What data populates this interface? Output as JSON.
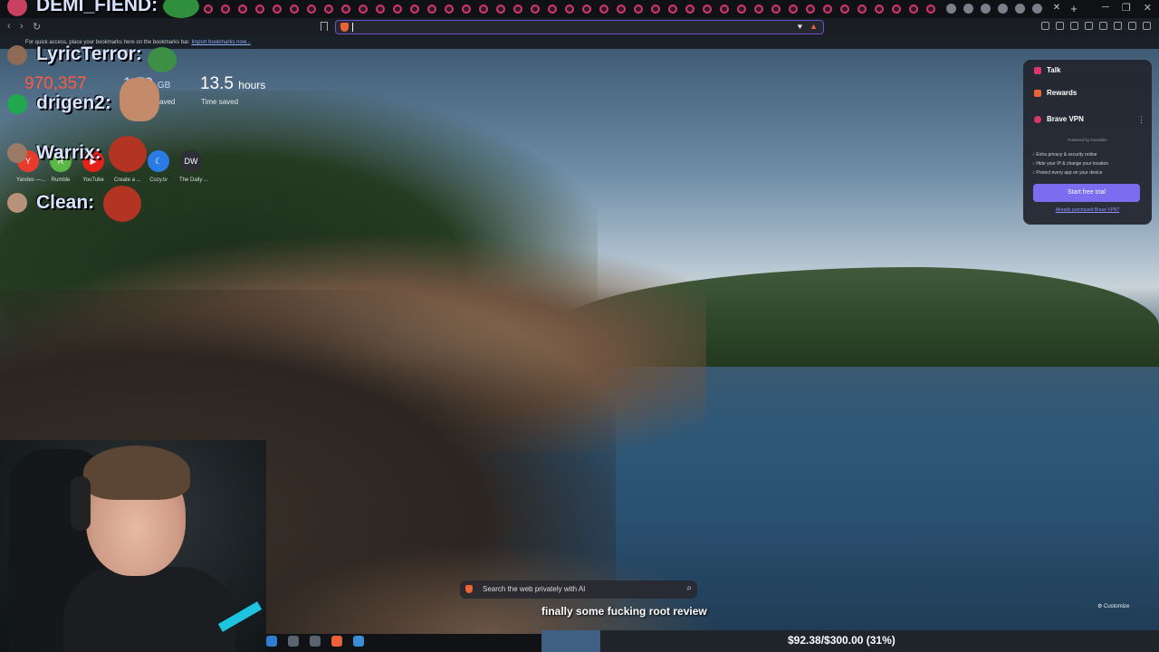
{
  "browser": {
    "url_value": "",
    "bookmarks_hint": "For quick access, place your bookmarks here on the bookmarks bar.",
    "import_link": "Import bookmarks now..."
  },
  "stats": {
    "trackers_value": "970,357",
    "bandwidth_value": "1.79",
    "bandwidth_unit": "GB",
    "bandwidth_caption": "saved",
    "time_value": "13.5",
    "time_unit": "hours",
    "time_caption": "Time saved"
  },
  "top_sites": [
    {
      "label": "Yandex —...",
      "icon": "Y",
      "color": "#e83b2e"
    },
    {
      "label": "Rumble",
      "icon": "R",
      "color": "#5ab945"
    },
    {
      "label": "YouTube",
      "icon": "▶",
      "color": "#e62117"
    },
    {
      "label": "Create a ...",
      "icon": "✎",
      "color": "#3a3c44"
    },
    {
      "label": "Cozy.tv",
      "icon": "☾",
      "color": "#2b7be4"
    },
    {
      "label": "The Daily ...",
      "icon": "DW",
      "color": "#2d2f36"
    }
  ],
  "chat": [
    {
      "name": "DEMI_FIEND:",
      "avatar_color": "#c94060"
    },
    {
      "name": "LyricTerror:",
      "avatar_color": "#8d6b54"
    },
    {
      "name": "drigen2:",
      "avatar_color": "#1fa84e"
    },
    {
      "name": "Warrix:",
      "avatar_color": "#9a7a64"
    },
    {
      "name": "Clean:",
      "avatar_color": "#b89278"
    }
  ],
  "panel": {
    "talk": "Talk",
    "rewards": "Rewards",
    "vpn": "Brave VPN",
    "powered": "Powered by Guardian",
    "bullets": [
      "Extra privacy & security online",
      "Hide your IP & change your location",
      "Protect every app on your device"
    ],
    "cta": "Start free trial",
    "link": "Already purchased Brave VPN?"
  },
  "search": {
    "placeholder": "Search the web privately with AI"
  },
  "customize": "Customize",
  "subtitle": "finally some fucking root review",
  "donation": {
    "text": "$92.38/$300.00 (31%)",
    "progress": 0.31
  },
  "colors": {
    "accent": "#7b6cf0",
    "brave_orange": "#e8623a",
    "tab_pink": "#d9366b"
  }
}
